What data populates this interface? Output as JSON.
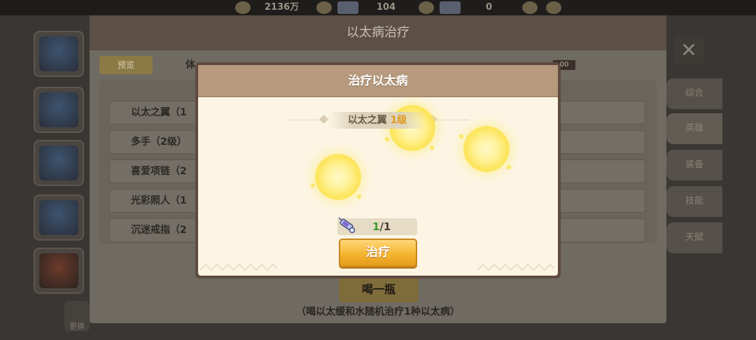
{
  "topbar": {
    "currency_1": "2136万",
    "currency_2": "104",
    "currency_3": "0"
  },
  "background_dialog": {
    "title": "以太病治疗",
    "preview_tag": "预览",
    "column_label": "体",
    "hp_value": "00",
    "rows": [
      "以太之翼（1",
      "多手（2级）",
      "喜爱项链（2",
      "光彩照人（1",
      "沉迷戒指（2"
    ],
    "drink_button": "喝一瓶",
    "note": "（喝以太缓和水随机治疗1种以太病）"
  },
  "right_tabs": [
    "综合",
    "英雄",
    "装备",
    "技能",
    "天赋"
  ],
  "bottom_left_label": "更换",
  "modal": {
    "title": "治疗以太病",
    "item_name": "以太之翼",
    "item_level": "1级",
    "counter_current": "1",
    "counter_total": "/1",
    "treat_button": "治疗"
  },
  "icons": [
    "coin-icon",
    "gem-icon",
    "diamond-icon",
    "close-icon",
    "syringe-icon",
    "light-orb-icon"
  ],
  "colors": {
    "modal_header": "#b79a7e",
    "modal_body": "#fcf5e4",
    "treat_button": "#f5b531",
    "level_text": "#e09a1a",
    "counter_current": "#3e9a2c"
  }
}
